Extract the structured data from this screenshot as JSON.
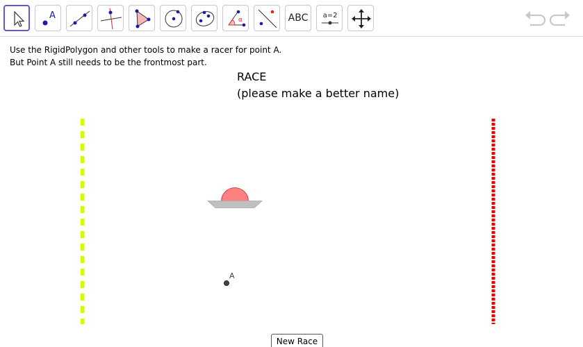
{
  "toolbar": {
    "tools": [
      {
        "name": "move-tool",
        "icon": "arrow-cursor-icon",
        "selected": true
      },
      {
        "name": "point-tool",
        "icon": "point-icon",
        "label": "A"
      },
      {
        "name": "line-tool",
        "icon": "line-icon"
      },
      {
        "name": "perpendicular-line-tool",
        "icon": "perpendicular-line-icon"
      },
      {
        "name": "polygon-tool",
        "icon": "polygon-icon"
      },
      {
        "name": "circle-tool",
        "icon": "circle-icon"
      },
      {
        "name": "conic-tool",
        "icon": "ellipse-icon"
      },
      {
        "name": "angle-tool",
        "icon": "angle-icon",
        "label": "α"
      },
      {
        "name": "reflect-tool",
        "icon": "reflect-icon"
      },
      {
        "name": "text-tool",
        "icon": "text-icon",
        "label": "ABC"
      },
      {
        "name": "slider-tool",
        "icon": "slider-icon",
        "label": "a=2"
      },
      {
        "name": "move-graphics-tool",
        "icon": "move-arrows-icon"
      }
    ],
    "undo_icon": "undo-icon",
    "redo_icon": "redo-icon"
  },
  "instructions": {
    "line1": "Use the RigidPolygon and other tools to make a racer for point A.",
    "line2": "But Point A still needs to be the frontmost part."
  },
  "title": {
    "line1": "RACE",
    "line2": "(please make a better name)"
  },
  "canvas": {
    "point_label": "A",
    "start_line_color": "#ccff00",
    "finish_line_color": "#ee0000",
    "racer_dome_color": "#ff8080",
    "racer_base_color": "#c0c0c0",
    "point_color": "#444444"
  },
  "buttons": {
    "new_race": "New Race"
  },
  "colors": {
    "selected_tool_border": "#6557d2",
    "tool_blue": "#1a1aa6"
  }
}
